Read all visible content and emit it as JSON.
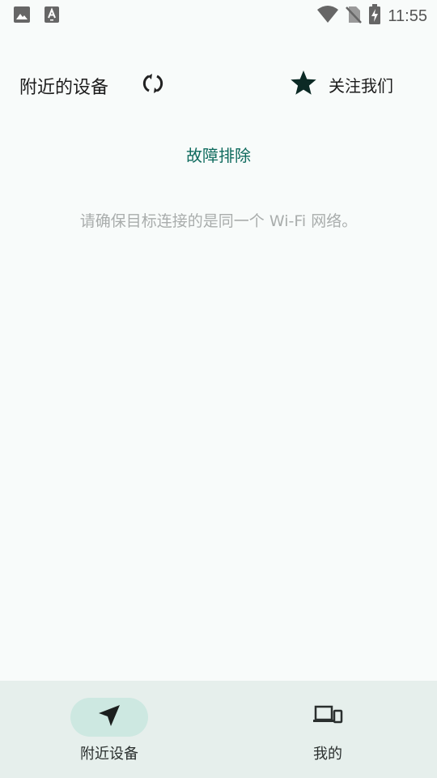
{
  "status_bar": {
    "time": "11:55",
    "icons": [
      "image-icon",
      "keyboard-a-icon",
      "wifi-icon",
      "no-sim-icon",
      "battery-charging-icon"
    ]
  },
  "header": {
    "title": "附近的设备",
    "refresh_icon": "refresh-icon",
    "follow_icon": "star-icon",
    "follow_label": "关注我们"
  },
  "main": {
    "troubleshoot_label": "故障排除",
    "hint": "请确保目标连接的是同一个 Wi-Fi 网络。"
  },
  "bottom_nav": {
    "items": [
      {
        "label": "附近设备",
        "icon": "navigation-arrow-icon",
        "selected": true
      },
      {
        "label": "我的",
        "icon": "devices-icon",
        "selected": false
      }
    ]
  },
  "colors": {
    "background": "#f8fbfa",
    "accent": "#0f6b5e",
    "nav_background": "#e6efec",
    "nav_selected_pill": "#cde8e1",
    "hint_text": "#a9adac"
  }
}
